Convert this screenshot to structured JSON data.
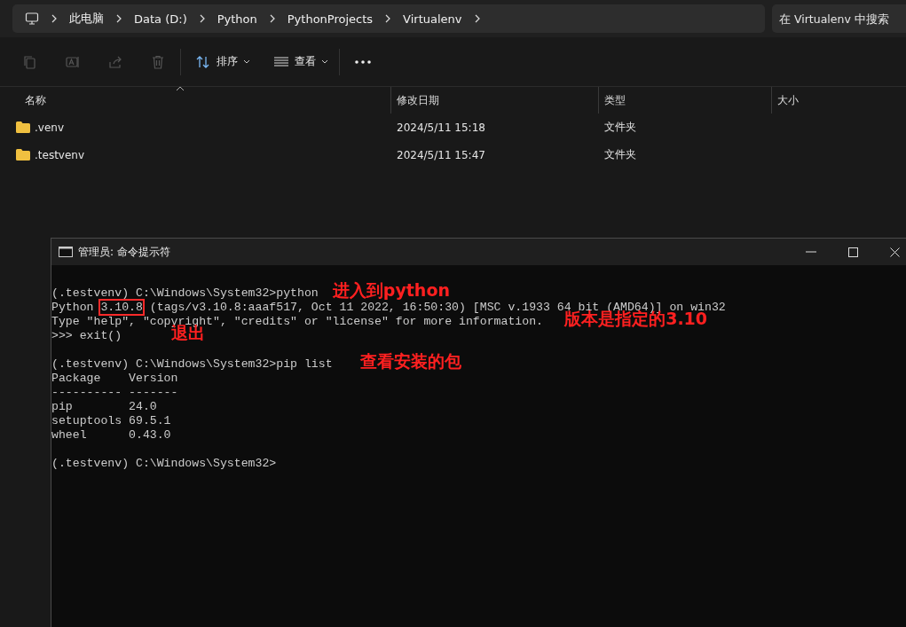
{
  "explorer": {
    "breadcrumb": [
      "此电脑",
      "Data (D:)",
      "Python",
      "PythonProjects",
      "Virtualenv"
    ],
    "search": {
      "placeholder": "在 Virtualenv 中搜索"
    },
    "toolbar": {
      "sort": "排序",
      "view": "查看"
    },
    "columns": [
      {
        "label": "名称",
        "sorted": true
      },
      {
        "label": "修改日期",
        "sorted": false
      },
      {
        "label": "类型",
        "sorted": false
      },
      {
        "label": "大小",
        "sorted": false
      }
    ],
    "rows": [
      {
        "name": ".venv",
        "modified": "2024/5/11 15:18",
        "type": "文件夹"
      },
      {
        "name": ".testvenv",
        "modified": "2024/5/11 15:47",
        "type": "文件夹"
      }
    ]
  },
  "console": {
    "title": "管理员: 命令提示符",
    "lines": [
      {
        "kind": "blank"
      },
      {
        "kind": "text",
        "parts": [
          {
            "text": "(.testvenv) C:\\Windows\\System32>python"
          }
        ]
      },
      {
        "kind": "text",
        "parts": [
          {
            "text": "Python "
          },
          {
            "text": "3.10.8",
            "boxed": true
          },
          {
            "text": " (tags/v3.10.8:aaaf517, Oct 11 2022, 16:50:30) [MSC v.1933 64 bit (AMD64)] on win32"
          }
        ]
      },
      {
        "kind": "text",
        "parts": [
          {
            "text": "Type \"help\", \"copyright\", \"credits\" or \"license\" for more information."
          }
        ]
      },
      {
        "kind": "text",
        "parts": [
          {
            "text": ">>> exit()"
          }
        ]
      },
      {
        "kind": "blank"
      },
      {
        "kind": "text",
        "parts": [
          {
            "text": "(.testvenv) C:\\Windows\\System32>pip list"
          }
        ]
      },
      {
        "kind": "text",
        "parts": [
          {
            "text": "Package    Version"
          }
        ]
      },
      {
        "kind": "text",
        "parts": [
          {
            "text": "---------- -------"
          }
        ]
      },
      {
        "kind": "text",
        "parts": [
          {
            "text": "pip        24.0"
          }
        ]
      },
      {
        "kind": "text",
        "parts": [
          {
            "text": "setuptools 69.5.1"
          }
        ]
      },
      {
        "kind": "text",
        "parts": [
          {
            "text": "wheel      0.43.0"
          }
        ]
      },
      {
        "kind": "blank"
      },
      {
        "kind": "text",
        "parts": [
          {
            "text": "(.testvenv) C:\\Windows\\System32>"
          }
        ]
      }
    ]
  },
  "annotations": [
    {
      "text": "进入到python"
    },
    {
      "text": "退出"
    },
    {
      "text": "版本是指定的3.10"
    },
    {
      "text": "查看安装的包"
    }
  ]
}
